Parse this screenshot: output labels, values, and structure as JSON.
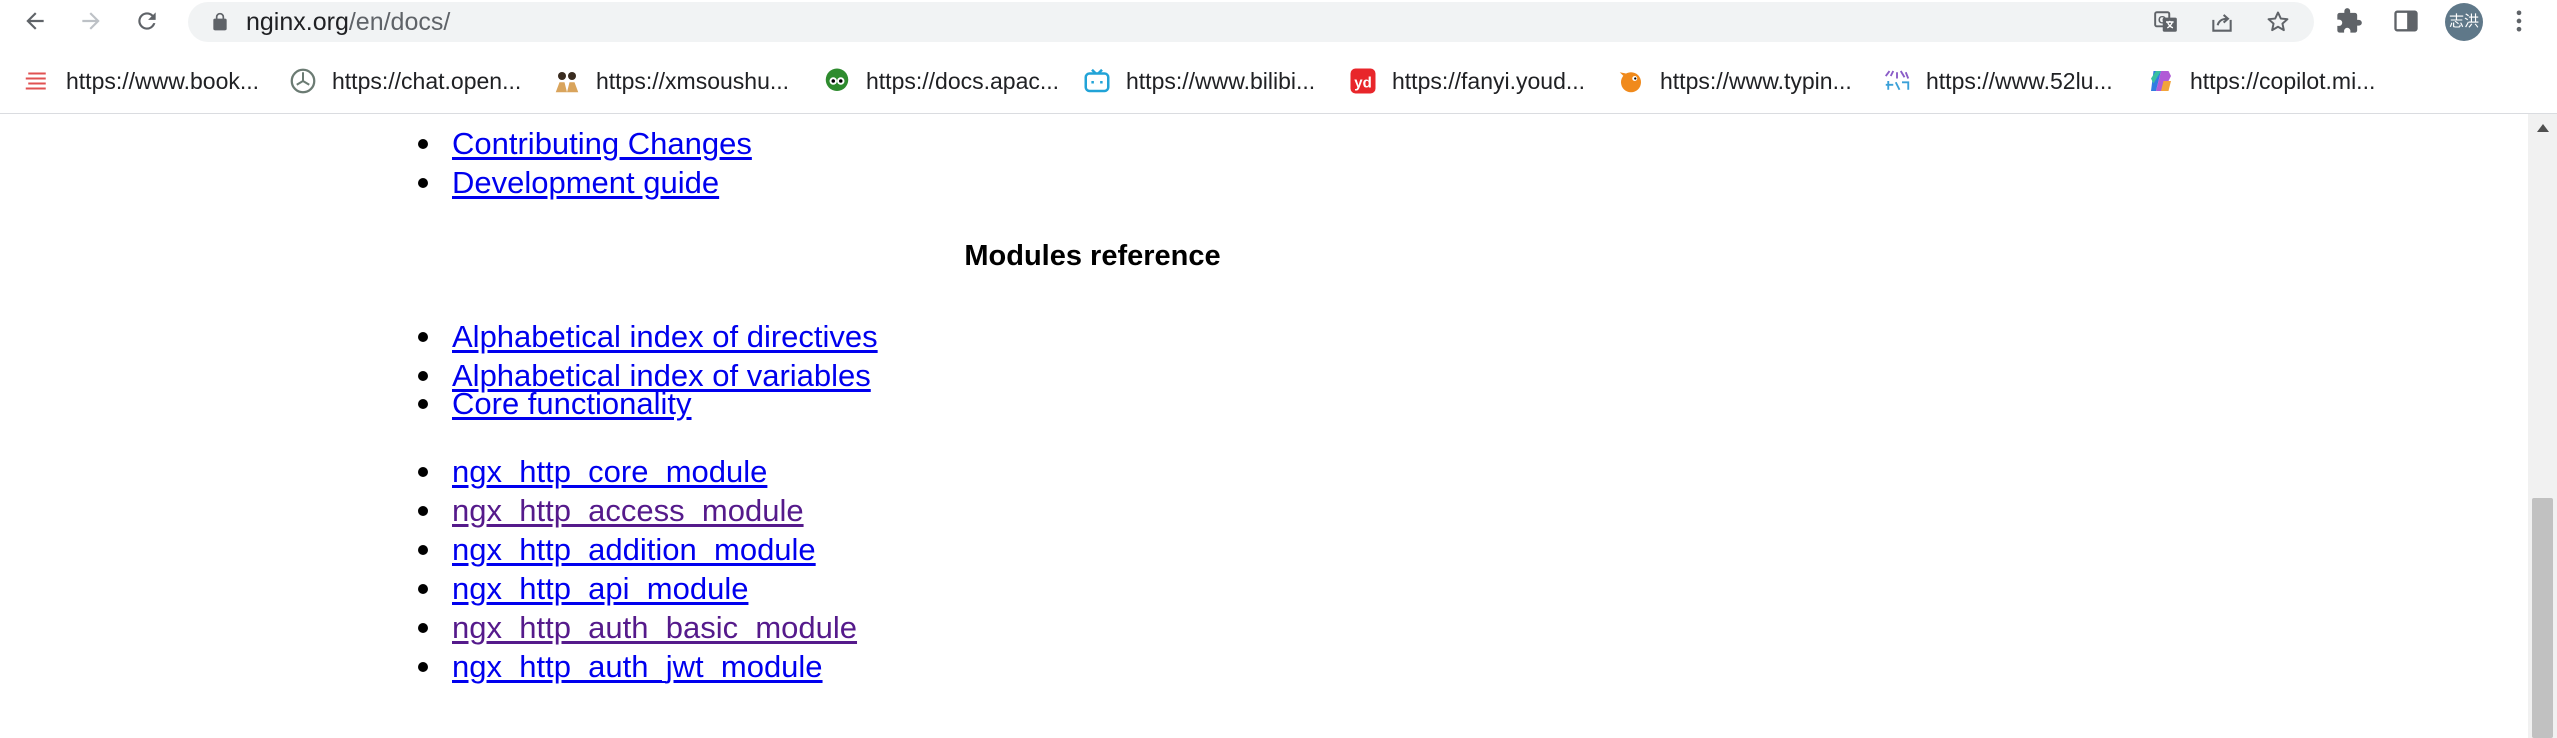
{
  "browser": {
    "url_host": "nginx.org",
    "url_path": "/en/docs/",
    "profile_initials": "志洪"
  },
  "bookmarks": [
    {
      "label": "https://www.book...",
      "icon": "list-lines-icon"
    },
    {
      "label": "https://chat.open...",
      "icon": "openai-icon"
    },
    {
      "label": "https://xmsoushu...",
      "icon": "cartoon-people-icon"
    },
    {
      "label": "https://docs.apac...",
      "icon": "green-mascot-icon"
    },
    {
      "label": "https://www.bilibi...",
      "icon": "bilibili-tv-icon"
    },
    {
      "label": "https://fanyi.youd...",
      "icon": "youdao-icon"
    },
    {
      "label": "https://www.typin...",
      "icon": "orange-bird-icon"
    },
    {
      "label": "https://www.52lu...",
      "icon": "colorful-text-icon"
    },
    {
      "label": "https://copilot.mi...",
      "icon": "copilot-icon"
    }
  ],
  "page": {
    "top_links": [
      {
        "label": "Contributing Changes",
        "visited": false
      },
      {
        "label": "Development guide",
        "visited": false
      }
    ],
    "section_heading": "Modules reference",
    "index_links": [
      {
        "label": "Alphabetical index of directives",
        "visited": false
      },
      {
        "label": "Alphabetical index of variables",
        "visited": false
      }
    ],
    "core_links": [
      {
        "label": "Core functionality",
        "visited": false
      }
    ],
    "module_links": [
      {
        "label": "ngx_http_core_module",
        "visited": false
      },
      {
        "label": "ngx_http_access_module",
        "visited": true
      },
      {
        "label": "ngx_http_addition_module",
        "visited": false
      },
      {
        "label": "ngx_http_api_module",
        "visited": false
      },
      {
        "label": "ngx_http_auth_basic_module",
        "visited": true
      },
      {
        "label": "ngx_http_auth_jwt_module",
        "visited": false
      }
    ]
  },
  "colors": {
    "link": "#0000ee",
    "visited_link": "#551a8b",
    "omnibox_bg": "#f1f3f4",
    "avatar_bg": "#5f7889"
  }
}
